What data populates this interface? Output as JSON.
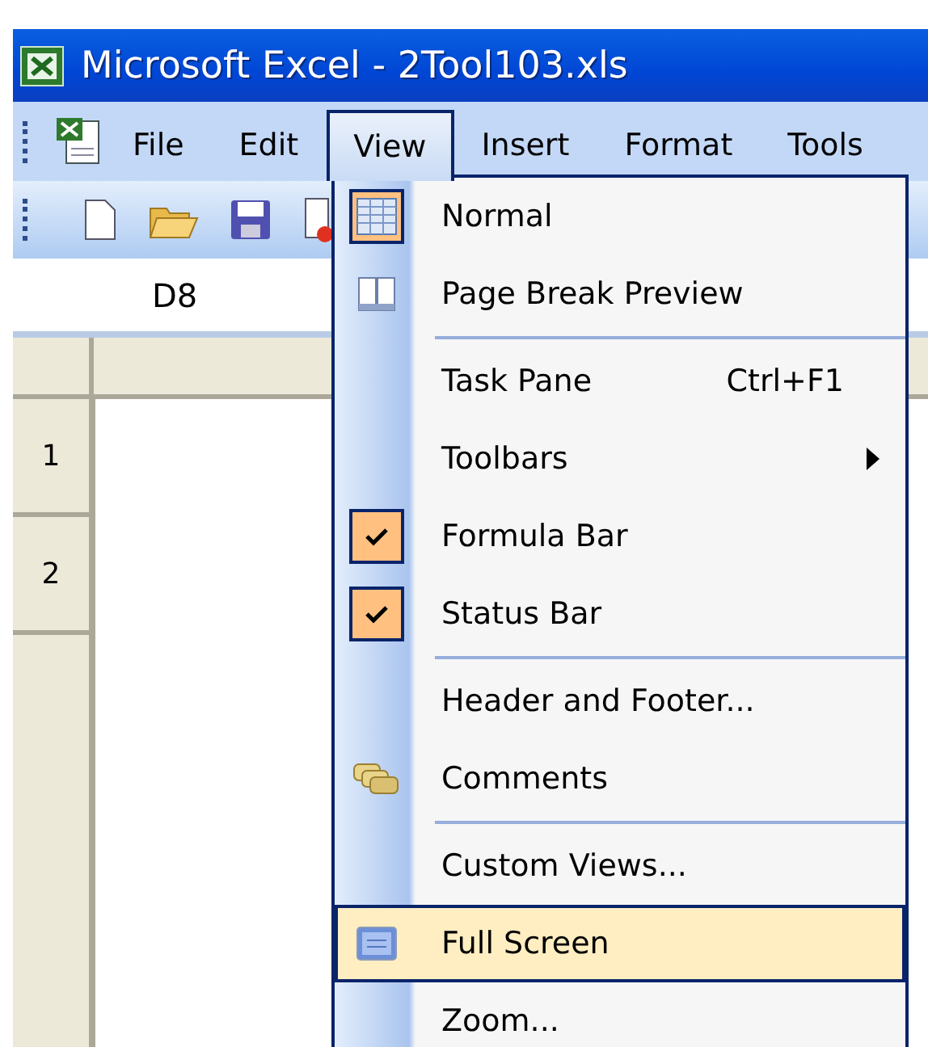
{
  "window": {
    "title": "Microsoft Excel - 2Tool103.xls"
  },
  "menu_bar": [
    {
      "label": "File",
      "selected": false
    },
    {
      "label": "Edit",
      "selected": false
    },
    {
      "label": "View",
      "selected": true
    },
    {
      "label": "Insert",
      "selected": false
    },
    {
      "label": "Format",
      "selected": false
    },
    {
      "label": "Tools",
      "selected": false
    }
  ],
  "name_box": "D8",
  "row_headers": [
    "1",
    "2"
  ],
  "view_menu": [
    {
      "kind": "item",
      "label": "Normal",
      "checked": true,
      "highlighted": false
    },
    {
      "kind": "item",
      "label": "Page Break Preview",
      "checked": false,
      "highlighted": false
    },
    {
      "kind": "separator"
    },
    {
      "kind": "item",
      "label": "Task Pane",
      "shortcut": "Ctrl+F1",
      "checked": false,
      "highlighted": false
    },
    {
      "kind": "submenu",
      "label": "Toolbars",
      "checked": false,
      "highlighted": false
    },
    {
      "kind": "item",
      "label": "Formula Bar",
      "checked": true,
      "highlighted": false
    },
    {
      "kind": "item",
      "label": "Status Bar",
      "checked": true,
      "highlighted": false
    },
    {
      "kind": "separator"
    },
    {
      "kind": "item",
      "label": "Header and Footer...",
      "checked": false,
      "highlighted": false
    },
    {
      "kind": "item",
      "label": "Comments",
      "checked": false,
      "highlighted": false
    },
    {
      "kind": "separator"
    },
    {
      "kind": "item",
      "label": "Custom Views...",
      "checked": false,
      "highlighted": false
    },
    {
      "kind": "item",
      "label": "Full Screen",
      "checked": false,
      "highlighted": true
    },
    {
      "kind": "item",
      "label": "Zoom...",
      "checked": false,
      "highlighted": false
    }
  ]
}
